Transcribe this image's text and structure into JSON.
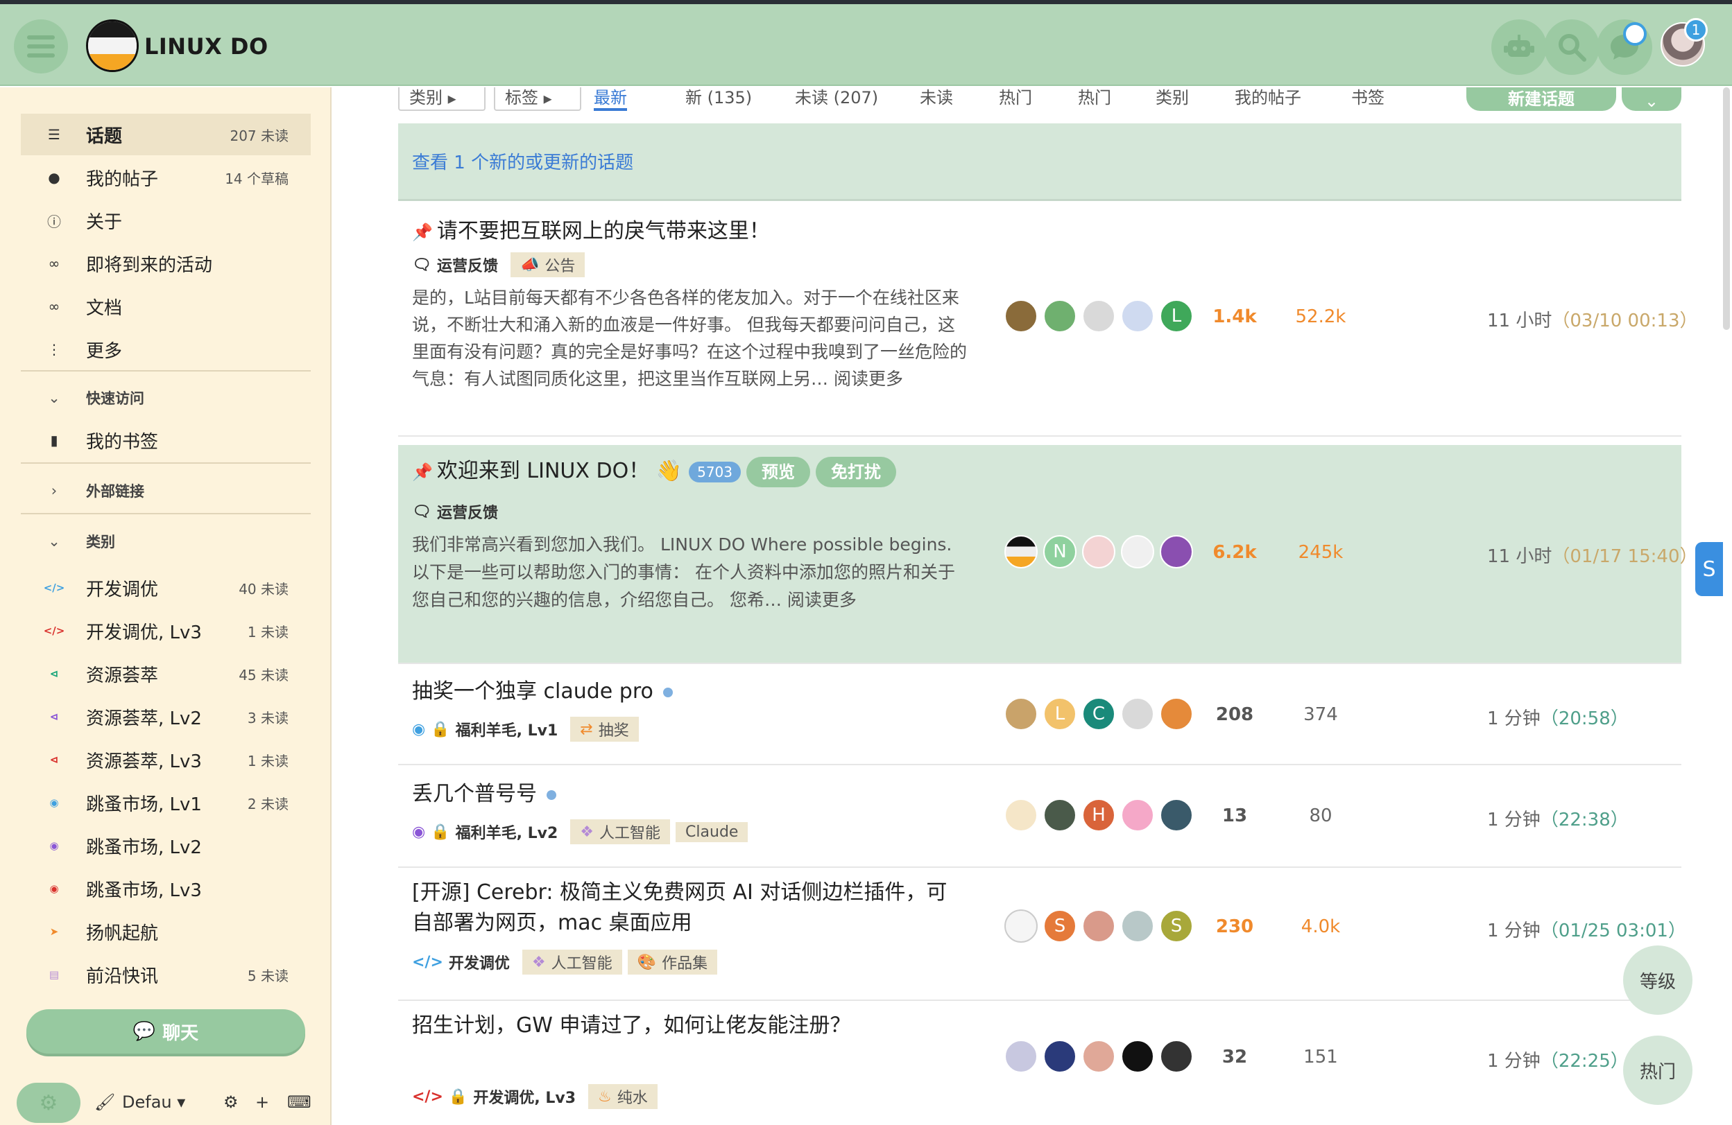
{
  "header": {
    "brand": "LINUX DO",
    "notification_count": "1"
  },
  "sidebar": {
    "items": [
      {
        "label": "话题",
        "count": "207 未读"
      },
      {
        "label": "我的帖子",
        "count": "14 个草稿"
      },
      {
        "label": "关于",
        "count": ""
      },
      {
        "label": "即将到来的活动",
        "count": ""
      },
      {
        "label": "文档",
        "count": ""
      },
      {
        "label": "更多",
        "count": ""
      }
    ],
    "quick_access_title": "快速访问",
    "bookmarks_label": "我的书签",
    "external_links_title": "外部链接",
    "categories_title": "类别",
    "categories": [
      {
        "label": "开发调优",
        "count": "40 未读",
        "color": "#3fa0e0",
        "icon": "code-icon"
      },
      {
        "label": "开发调优, Lv3",
        "count": "1 未读",
        "color": "#d9302c",
        "icon": "code-lock-icon"
      },
      {
        "label": "资源荟萃",
        "count": "45 未读",
        "color": "#1aa57a",
        "icon": "share-icon"
      },
      {
        "label": "资源荟萃, Lv2",
        "count": "3 未读",
        "color": "#8a56d6",
        "icon": "share-lock-icon"
      },
      {
        "label": "资源荟萃, Lv3",
        "count": "1 未读",
        "color": "#d9302c",
        "icon": "share-lock-icon"
      },
      {
        "label": "跳蚤市场, Lv1",
        "count": "2 未读",
        "color": "#3fa0e0",
        "icon": "coins-icon"
      },
      {
        "label": "跳蚤市场, Lv2",
        "count": "",
        "color": "#8a56d6",
        "icon": "coins-icon"
      },
      {
        "label": "跳蚤市场, Lv3",
        "count": "",
        "color": "#d9302c",
        "icon": "coins-icon"
      },
      {
        "label": "扬帆起航",
        "count": "",
        "color": "#f08a2c",
        "icon": "rocket-icon"
      },
      {
        "label": "前沿快讯",
        "count": "5 未读",
        "color": "#b48ad6",
        "icon": "newspaper-icon"
      }
    ],
    "chat_label": "聊天",
    "footer_theme": "Defau"
  },
  "tabs": {
    "categories_drop": "类别",
    "tags_drop": "标签",
    "latest": "最新",
    "new": "新 (135)",
    "unread": "未读 (207)",
    "unseen": "未读",
    "hot1": "热门",
    "hot2": "热门",
    "categories": "类别",
    "my_posts": "我的帖子",
    "bookmarks": "书签",
    "new_topic": "新建话题"
  },
  "banner": "查看 1 个新的或更新的话题",
  "topics": [
    {
      "title": "请不要把互联网上的戾气带来这里！",
      "category": "运营反馈",
      "tags": [
        "公告"
      ],
      "excerpt": "是的，L站目前每天都有不少各色各样的佬友加入。对于一个在线社区来说，不断壮大和涌入新的血液是一件好事。 但我每天都要问问自己，这里面有没有问题？真的完全是好事吗？在这个过程中我嗅到了一丝危险的气息：有人试图同质化这里，把这里当作互联网上另… 阅读更多",
      "replies": "1.4k",
      "views": "52.2k",
      "activity": "11 小时",
      "date": "（03/10 00:13）"
    },
    {
      "title": "欢迎来到 LINUX DO！",
      "badge": "5703",
      "pill1": "预览",
      "pill2": "免打扰",
      "category": "运营反馈",
      "excerpt": "我们非常高兴看到您加入我们。 LINUX DO Where possible begins. 以下是一些可以帮助您入门的事情： 在个人资料中添加您的照片和关于您自己和您的兴趣的信息，介绍您自己。 您希… 阅读更多",
      "replies": "6.2k",
      "views": "245k",
      "activity": "11 小时",
      "date": "（01/17 15:40）"
    },
    {
      "title": "抽奖一个独享 claude pro",
      "category": "福利羊毛, Lv1",
      "tags": [
        "抽奖"
      ],
      "replies": "208",
      "views": "374",
      "activity": "1 分钟",
      "date": "（20:58）"
    },
    {
      "title": "丢几个普号号",
      "category": "福利羊毛, Lv2",
      "tags": [
        "人工智能",
        "Claude"
      ],
      "replies": "13",
      "views": "80",
      "activity": "1 分钟",
      "date": "（22:38）"
    },
    {
      "title_line1": "[开源] Cerebr: 极简主义免费网页 AI 对话侧边栏插件，可",
      "title_line2": "自部署为网页，mac 桌面应用",
      "category": "开发调优",
      "tags": [
        "人工智能",
        "作品集"
      ],
      "replies": "230",
      "views": "4.0k",
      "activity": "1 分钟",
      "date": "（01/25 03:01）"
    },
    {
      "title": "招生计划，GW 申请过了，如何让佬友能注册？",
      "category": "开发调优, Lv3",
      "tags": [
        "纯水"
      ],
      "replies": "32",
      "views": "151",
      "activity": "1 分钟",
      "date": "（22:25）"
    }
  ],
  "floating": {
    "level": "等级",
    "hot": "热门",
    "side_tab": "S"
  }
}
